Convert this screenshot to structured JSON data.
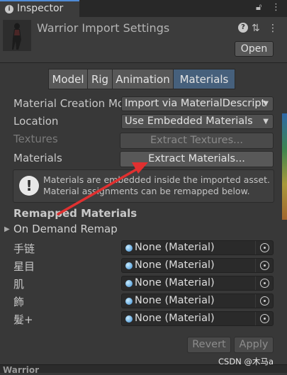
{
  "tab": {
    "label": "Inspector"
  },
  "header": {
    "title": "Warrior Import Settings",
    "open_label": "Open",
    "icons": [
      "info-icon",
      "presets-icon",
      "more-icon"
    ]
  },
  "toolbar": {
    "tabs": [
      {
        "label": "Model"
      },
      {
        "label": "Rig"
      },
      {
        "label": "Animation"
      },
      {
        "label": "Materials",
        "active": true
      }
    ]
  },
  "settings": {
    "material_creation_mode": {
      "label": "Material Creation Mo",
      "value": "Import via MaterialDescript"
    },
    "location": {
      "label": "Location",
      "value": "Use Embedded Materials"
    },
    "textures": {
      "label": "Textures",
      "button": "Extract Textures..."
    },
    "materials": {
      "label": "Materials",
      "button": "Extract Materials..."
    }
  },
  "help": {
    "line1": "Materials are embedded inside the imported asset.",
    "line2": "Material assignments can be remapped below."
  },
  "remapped": {
    "header": "Remapped Materials",
    "foldout": "On Demand Remap",
    "rows": [
      {
        "label": "手链",
        "value": "None (Material)"
      },
      {
        "label": "星目",
        "value": "None (Material)"
      },
      {
        "label": "肌",
        "value": "None (Material)"
      },
      {
        "label": "飾",
        "value": "None (Material)"
      },
      {
        "label": "髮+",
        "value": "None (Material)"
      }
    ]
  },
  "footer": {
    "revert": "Revert",
    "apply": "Apply"
  },
  "bottom": {
    "label": "Warrior"
  },
  "watermark": "CSDN @木马a",
  "colors": {
    "accent": "#4f8bd6",
    "active_tab": "#46607c",
    "arrow": "#e03030"
  }
}
